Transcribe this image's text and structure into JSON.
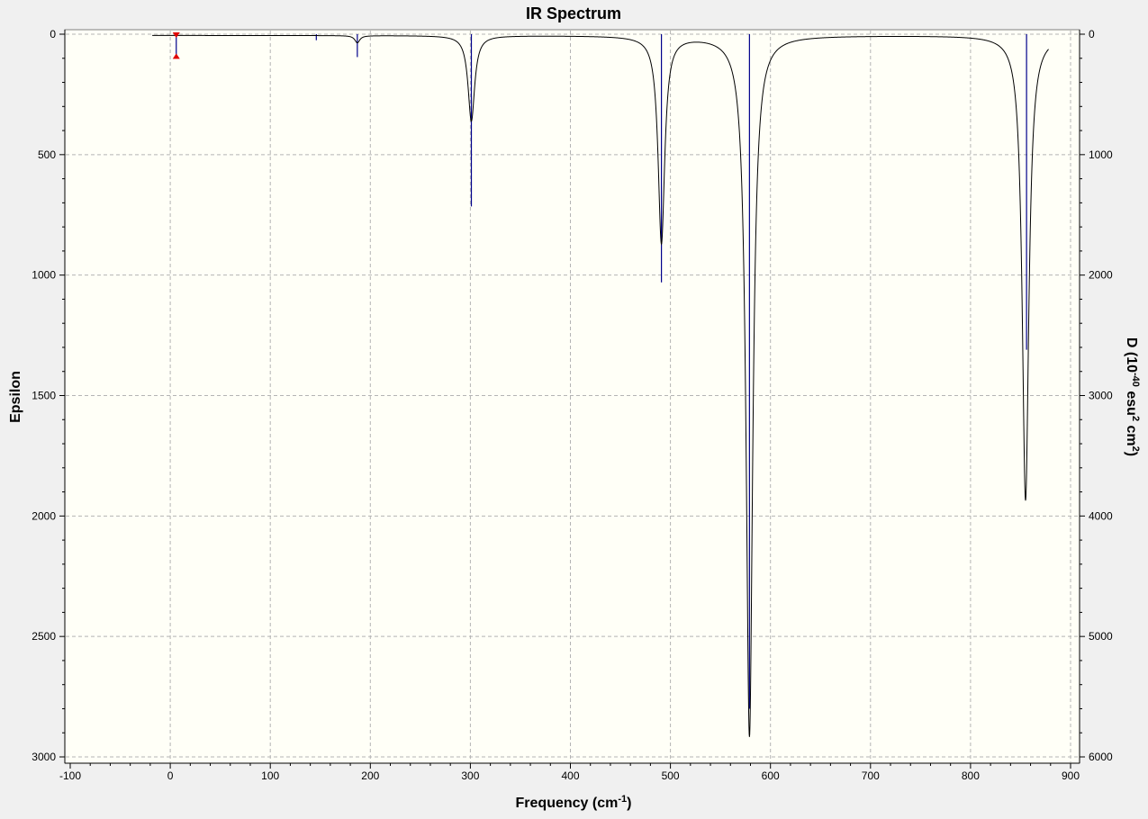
{
  "colors": {
    "window_bg": "#f0f0f0",
    "plot_bg": "#fffff7",
    "grid": "#b4b4b4",
    "spectrum_line": "#000000",
    "stick_line": "#00008b",
    "marker": "#e00000"
  },
  "chart_data": {
    "type": "line",
    "title": "IR Spectrum",
    "xlabel": "Frequency (cm",
    "xlabel_sup": "-1",
    "xlabel_tail": ")",
    "ylabel_left": "Epsilon",
    "ylabel_right_parts": [
      "D (10",
      "-40",
      " esu",
      "2",
      " cm",
      "2",
      ")"
    ],
    "xlim": [
      -100,
      900
    ],
    "ylim_left": [
      0,
      3000
    ],
    "ylim_right": [
      0,
      6000
    ],
    "y_inverted": true,
    "grid": true,
    "x_ticks": [
      -100,
      0,
      100,
      200,
      300,
      400,
      500,
      600,
      700,
      800,
      900
    ],
    "y_left_ticks": [
      0,
      500,
      1000,
      1500,
      2000,
      2500,
      3000
    ],
    "y_right_ticks": [
      0,
      1000,
      2000,
      3000,
      4000,
      5000,
      6000
    ],
    "series": [
      {
        "kind": "lorentzian_sum",
        "axis": "left",
        "x_range": [
          -18,
          878
        ],
        "baseline": 5,
        "peaks": [
          {
            "x": 187,
            "height": 30,
            "width": 3
          },
          {
            "x": 301,
            "height": 355,
            "width": 4
          },
          {
            "x": 491,
            "height": 860,
            "width": 4
          },
          {
            "x": 579,
            "height": 2910,
            "width": 4
          },
          {
            "x": 855,
            "height": 1930,
            "width": 4
          }
        ]
      },
      {
        "kind": "sticks",
        "axis": "right",
        "points": [
          {
            "x": 146,
            "value": 50
          },
          {
            "x": 187,
            "value": 190
          },
          {
            "x": 301,
            "value": 1430
          },
          {
            "x": 491,
            "value": 2060
          },
          {
            "x": 579,
            "value": 5600
          },
          {
            "x": 856,
            "value": 2620
          }
        ]
      }
    ],
    "annotations": [
      {
        "type": "error-marker",
        "x": 6,
        "y_top": 0,
        "y_bottom": 95
      }
    ]
  }
}
